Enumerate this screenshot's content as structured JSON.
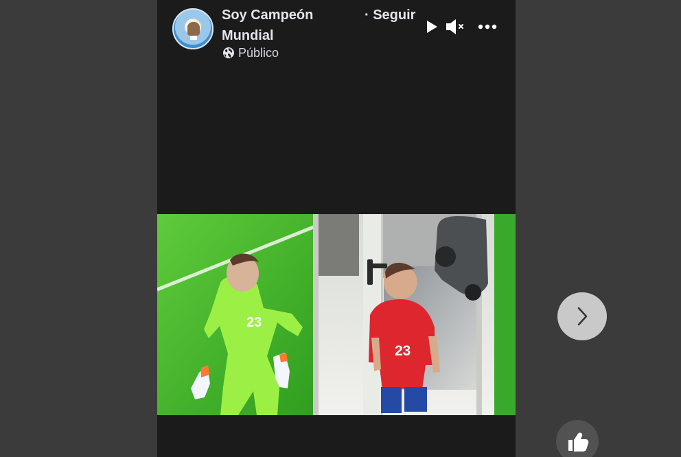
{
  "colors": {
    "background": "#3b3b3b",
    "viewer": "#1b1b1c",
    "header_text": "#e4e6eb",
    "secondary_text": "#d5d7dc",
    "next_button": "#c9c9c9",
    "like_button": "#525252"
  },
  "post": {
    "page_name": "Soy Campeón Mundial",
    "follow_label": "· Seguir",
    "audience_label": "Público",
    "audience_icon": "globe-icon"
  },
  "controls": {
    "play_icon": "play-icon",
    "mute_icon": "muted-volume-icon",
    "more_icon": "more-options-icon"
  },
  "media": {
    "left_player_number": "23",
    "right_shirt_number": "23"
  },
  "navigation": {
    "next_icon": "chevron-right-icon",
    "like_icon": "thumbs-up-icon"
  }
}
